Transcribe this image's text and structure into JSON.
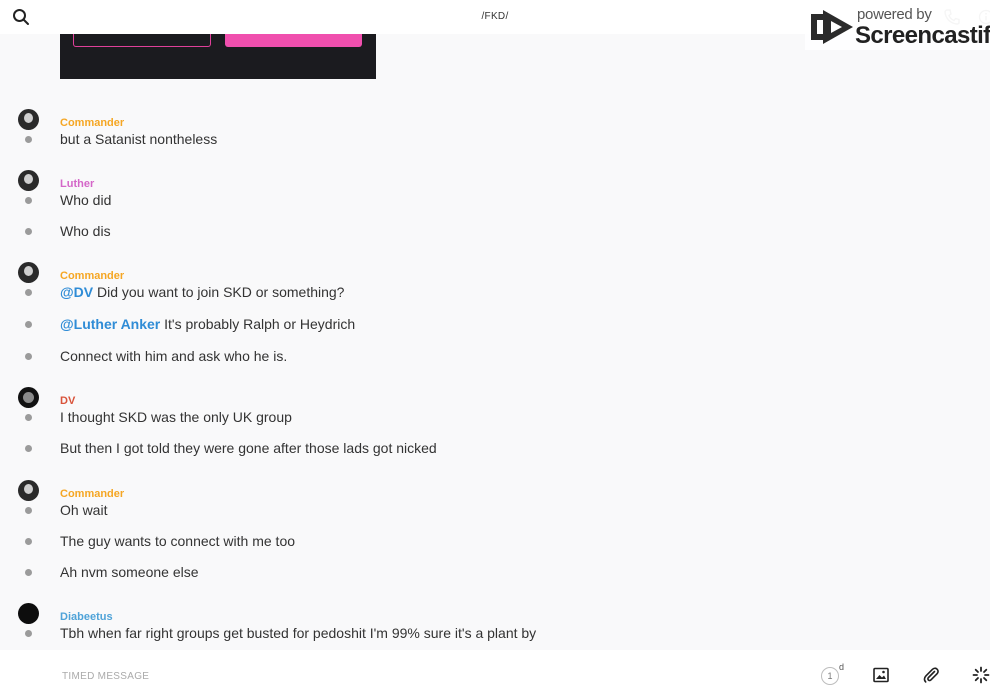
{
  "header": {
    "channel_title": "/FKD/",
    "search_icon": "search-icon",
    "call_icon": "phone-icon",
    "info_icon": "info-icon"
  },
  "watermark": {
    "line1": "powered by",
    "line2": "Screencastify"
  },
  "colors": {
    "commander": "#f5a623",
    "luther": "#d466c8",
    "dv": "#d9533a",
    "diabeetus": "#4fa3d8",
    "mention": "#2f8cd6",
    "embed_accent": "#f04fae"
  },
  "messages": [
    {
      "type": "author",
      "name": "Commander",
      "avatar": "commander"
    },
    {
      "type": "text",
      "text": "but a Satanist nontheless"
    },
    {
      "type": "author",
      "name": "Luther",
      "avatar": "luther"
    },
    {
      "type": "text",
      "text": "Who did"
    },
    {
      "type": "text",
      "text": "Who dis"
    },
    {
      "type": "author",
      "name": "Commander",
      "avatar": "commander"
    },
    {
      "type": "text",
      "mention": "@DV",
      "text": " Did you want to join SKD or something?"
    },
    {
      "type": "text",
      "mention": "@Luther Anker",
      "text": " It's probably Ralph or Heydrich"
    },
    {
      "type": "text",
      "text": "Connect with him and ask who he is."
    },
    {
      "type": "author",
      "name": "DV",
      "avatar": "dv"
    },
    {
      "type": "text",
      "text": "I thought SKD was the only UK group"
    },
    {
      "type": "text",
      "text": "But then I got told they were gone after those lads got nicked"
    },
    {
      "type": "author",
      "name": "Commander",
      "avatar": "commander"
    },
    {
      "type": "text",
      "text": "Oh wait"
    },
    {
      "type": "text",
      "text": "The guy wants to connect with me too"
    },
    {
      "type": "text",
      "text": "Ah nvm someone else"
    },
    {
      "type": "author",
      "name": "Diabeetus",
      "avatar": "diabeetus"
    },
    {
      "type": "text",
      "text": "Tbh when far right groups get busted for pedoshit I'm 99% sure it's a plant by"
    }
  ],
  "composer": {
    "placeholder": "TIMED MESSAGE",
    "timer_value": "1",
    "timer_unit": "d",
    "image_icon": "image-icon",
    "attach_icon": "paperclip-icon",
    "ping_icon": "ping-icon"
  }
}
